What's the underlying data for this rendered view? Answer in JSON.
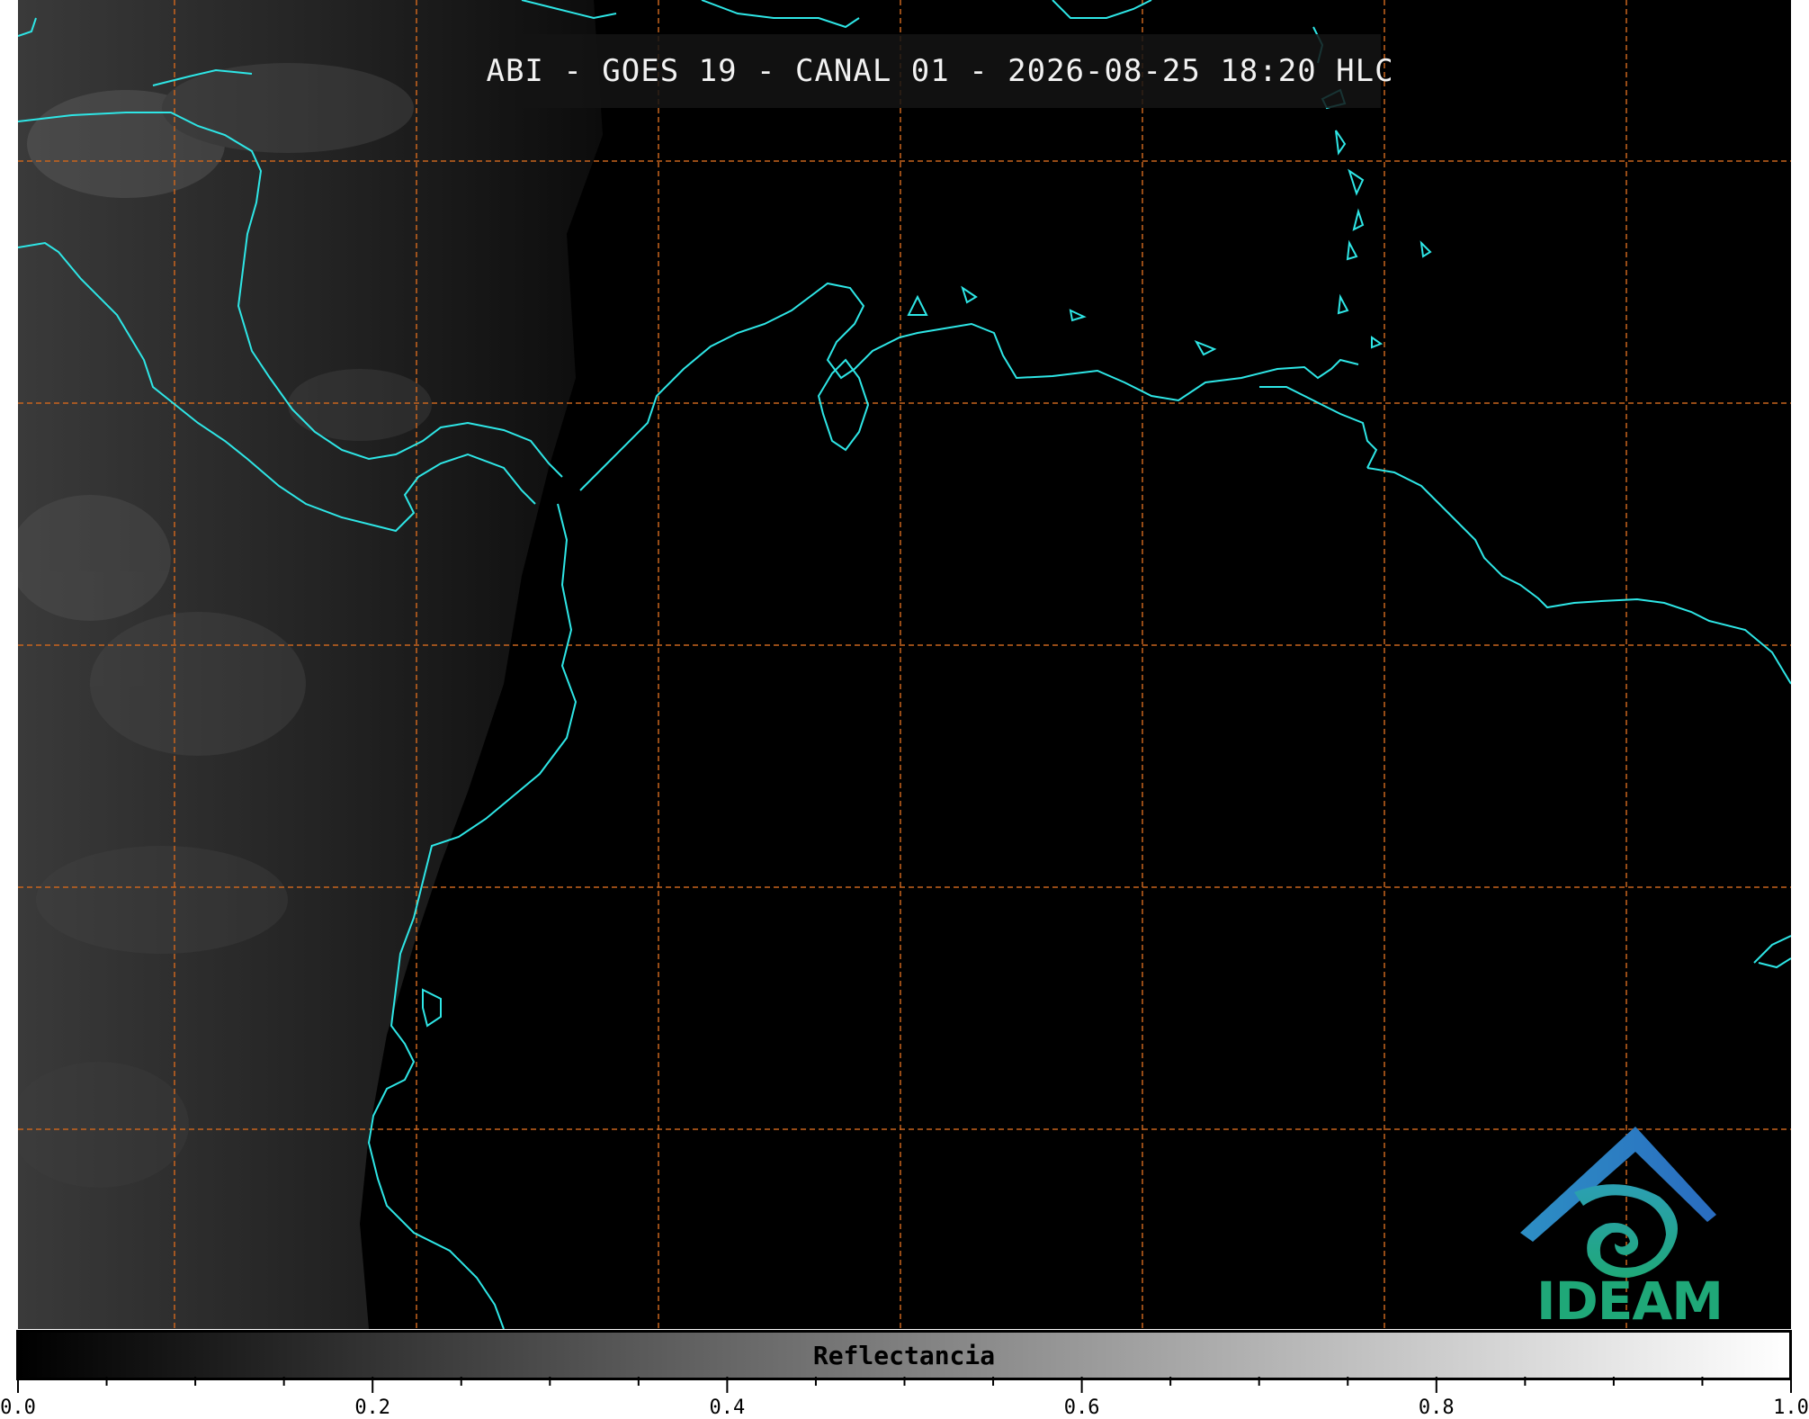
{
  "title": "ABI - GOES 19 - CANAL 01 - 2026-08-25 18:20 HLC",
  "logo": {
    "text": "IDEAM",
    "icon": "ideam-logo-icon",
    "color": "#1fa878"
  },
  "colorbar": {
    "label": "Reflectancia",
    "range": [
      0.0,
      1.0
    ],
    "ticks": [
      "0.0",
      "0.2",
      "0.4",
      "0.6",
      "0.8",
      "1.0"
    ],
    "colormap": [
      "#000000",
      "#ffffff"
    ]
  },
  "map": {
    "background": "#000000",
    "coastline_color": "#2ee6e6",
    "grid_color": "#c8641e",
    "grid_style": "dashed"
  }
}
